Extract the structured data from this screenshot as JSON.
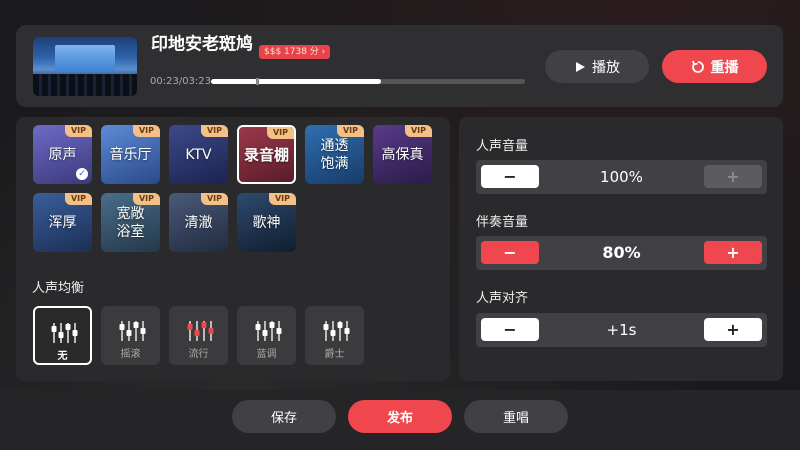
{
  "player": {
    "title": "印地安老斑鸠",
    "price": "$$$ 1738 分 ›",
    "time": "00:23/03:23",
    "progress": 0.54,
    "play_label": "播放",
    "replay_label": "重播"
  },
  "effects": [
    {
      "label": "原声",
      "vip": "VIP",
      "selected_check": true,
      "colors": [
        "#6e6ac8",
        "#3b3a7a"
      ]
    },
    {
      "label": "音乐厅",
      "vip": "VIP",
      "colors": [
        "#5d8bd6",
        "#2b4a8c"
      ]
    },
    {
      "label": "KTV",
      "vip": "VIP",
      "colors": [
        "#3d4a8a",
        "#1c2350"
      ]
    },
    {
      "label": "录音棚",
      "vip": "VIP",
      "selected": true,
      "colors": [
        "#9a3a4a",
        "#5a1c2a"
      ]
    },
    {
      "label": "通透\n饱满",
      "vip": "VIP",
      "colors": [
        "#2f6fb0",
        "#173c6a"
      ]
    },
    {
      "label": "高保真",
      "vip": "VIP",
      "colors": [
        "#5a3a8a",
        "#2a1c48"
      ]
    },
    {
      "label": "浑厚",
      "vip": "VIP",
      "colors": [
        "#3a5e9a",
        "#1c2f56"
      ]
    },
    {
      "label": "宽敞\n浴室",
      "vip": "VIP",
      "colors": [
        "#4a6e8a",
        "#24384a"
      ]
    },
    {
      "label": "清澈",
      "vip": "VIP",
      "colors": [
        "#4a5a7a",
        "#222c40"
      ]
    },
    {
      "label": "歌神",
      "vip": "VIP",
      "colors": [
        "#2d4a6e",
        "#111e30"
      ]
    }
  ],
  "eq": {
    "title": "人声均衡",
    "presets": [
      {
        "label": "无",
        "active": true,
        "color": "#ffffff"
      },
      {
        "label": "摇滚",
        "color": "#ffffff"
      },
      {
        "label": "流行",
        "color": "#f0474e"
      },
      {
        "label": "蓝调",
        "color": "#ffffff"
      },
      {
        "label": "爵士",
        "color": "#ffffff"
      }
    ]
  },
  "controls": {
    "vocal": {
      "label": "人声音量",
      "value": "100%",
      "minus": "−",
      "plus": "+"
    },
    "accomp": {
      "label": "伴奏音量",
      "value": "80%",
      "minus": "−",
      "plus": "+"
    },
    "align": {
      "label": "人声对齐",
      "value": "+1s",
      "minus": "−",
      "plus": "+"
    }
  },
  "bottom": {
    "save": "保存",
    "publish": "发布",
    "resing": "重唱"
  },
  "colors": {
    "accent": "#f0474e",
    "vip_badge": "#f3c088"
  }
}
